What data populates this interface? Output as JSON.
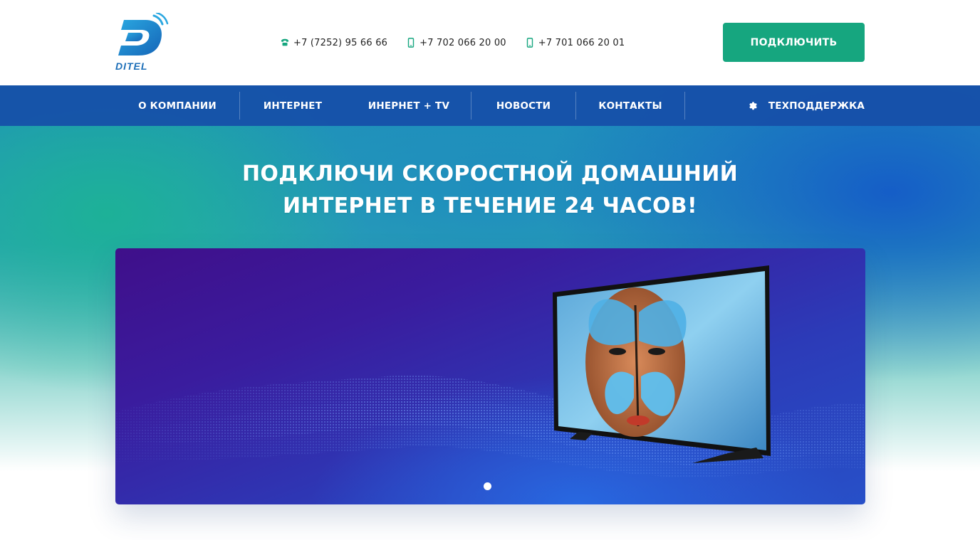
{
  "header": {
    "logo_text": "DITEL",
    "phones": [
      {
        "icon": "phone-icon",
        "number": "+7 (7252) 95 66 66"
      },
      {
        "icon": "mobile-icon",
        "number": "+7 702 066 20 00"
      },
      {
        "icon": "mobile-icon",
        "number": "+7 701 066 20 01"
      }
    ],
    "connect_label": "ПОДКЛЮЧИТЬ"
  },
  "nav": {
    "items": [
      {
        "label": "О КОМПАНИИ"
      },
      {
        "label": "ИНТЕРНЕТ"
      },
      {
        "label": "ИНЕРНЕТ + TV"
      },
      {
        "label": "НОВОСТИ"
      },
      {
        "label": "КОНТАКТЫ"
      }
    ],
    "support": {
      "icon": "gear-icon",
      "label": "ТЕХПОДДЕРЖКА"
    }
  },
  "hero": {
    "headline_line1": "ПОДКЛЮЧИ СКОРОСТНОЙ ДОМАШНИЙ",
    "headline_line2": "ИНТЕРНЕТ В ТЕЧЕНИЕ 24 ЧАСОВ!"
  },
  "slider": {
    "slide_count": 1,
    "active_slide": 1
  },
  "colors": {
    "accent_green": "#16a67f",
    "nav_blue": "#164ea8",
    "logo_blue": "#1d6fb8"
  }
}
